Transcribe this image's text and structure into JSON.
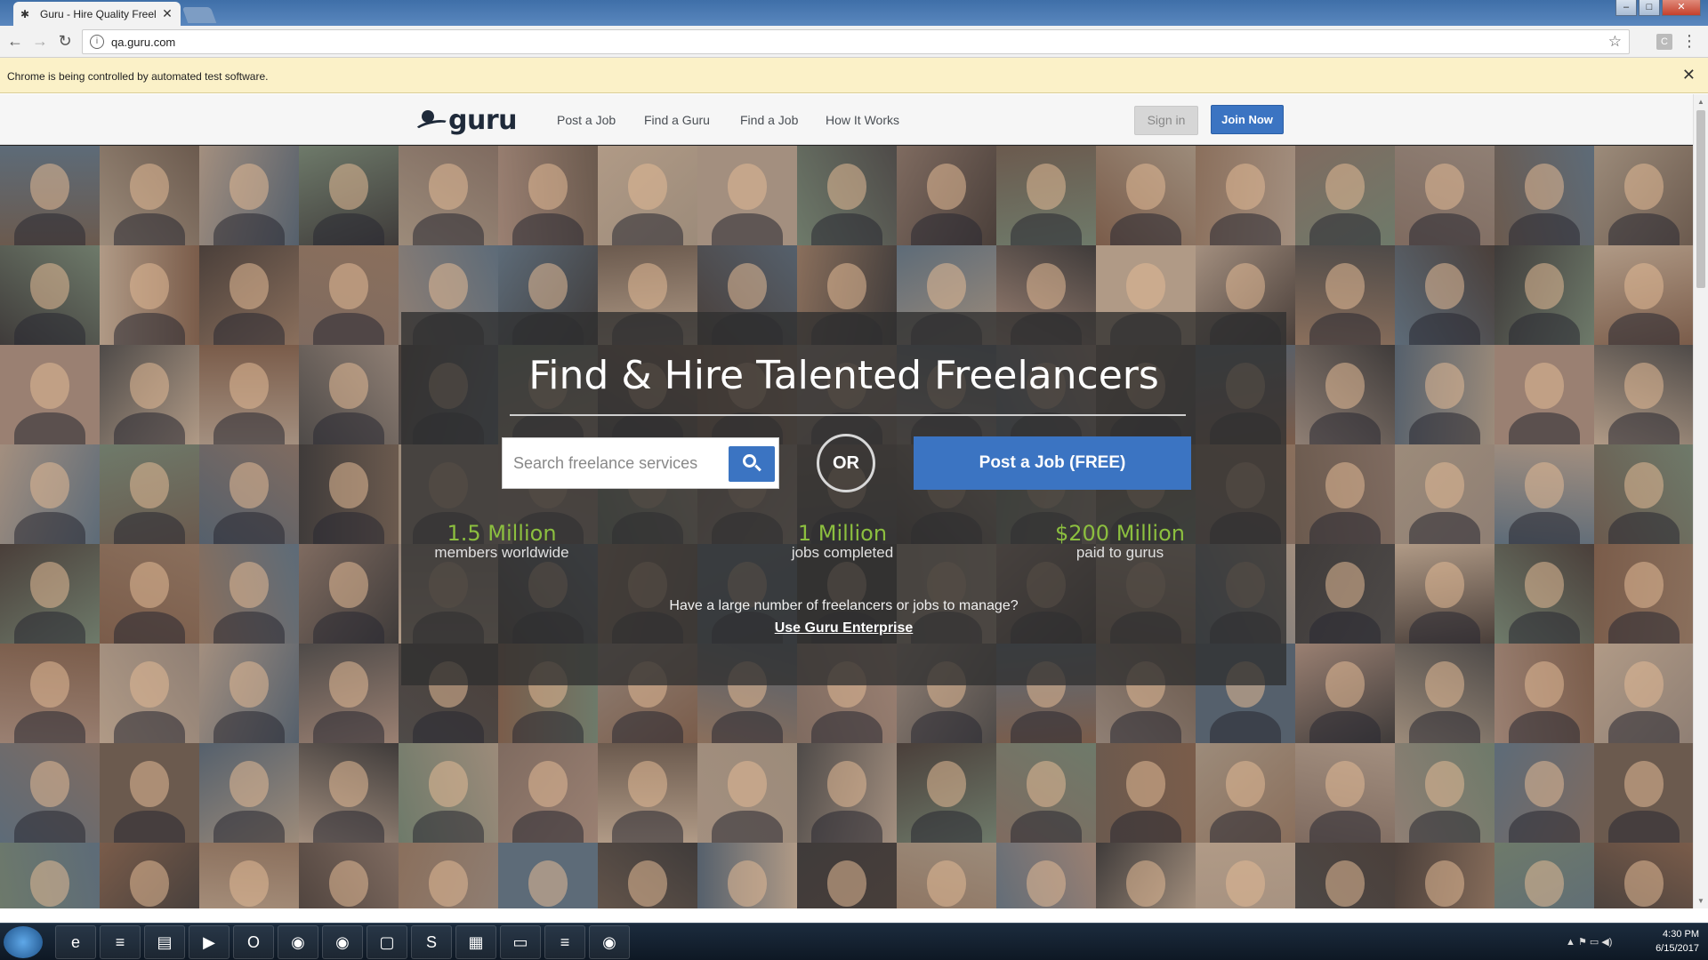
{
  "browser": {
    "tab_title": "Guru - Hire Quality Freel",
    "tab_close": "✕",
    "url": "qa.guru.com",
    "infobar_text": "Chrome is being controlled by automated test software.",
    "infobar_close": "✕",
    "window_controls": {
      "minimize": "–",
      "maximize": "□",
      "close": "✕"
    },
    "icons": {
      "back": "back-arrow-icon",
      "forward": "forward-arrow-icon",
      "reload": "reload-icon",
      "info": "info-icon",
      "star": "bookmark-star-icon",
      "menu": "menu-icon"
    }
  },
  "site_nav": {
    "logo_text": "guru",
    "links": [
      "Post a Job",
      "Find a Guru",
      "Find a Job",
      "How It Works"
    ],
    "sign_in": "Sign in",
    "join_now": "Join Now"
  },
  "hero": {
    "title": "Find & Hire Talented Freelancers",
    "search_placeholder": "Search freelance services",
    "or_label": "OR",
    "post_job_label": "Post a Job (FREE)",
    "stats": [
      {
        "number": "1.5 Million",
        "label": "members worldwide"
      },
      {
        "number": "1 Million",
        "label": "jobs completed"
      },
      {
        "number": "$200 Million",
        "label": "paid to gurus"
      }
    ],
    "enterprise_question": "Have a large number of freelancers or jobs to manage?",
    "enterprise_link": "Use Guru Enterprise"
  },
  "colors": {
    "accent_blue": "#3b74c2",
    "stat_green": "#8cbf3f",
    "infobar_bg": "#fbf1c8"
  },
  "taskbar": {
    "time": "4:30 PM",
    "date": "6/15/2017",
    "apps": [
      "ie-icon",
      "remote-desktop-icon",
      "file-explorer-icon",
      "media-player-icon",
      "outlook-icon",
      "chrome-icon",
      "firefox-icon",
      "folder-icon",
      "skype-icon",
      "control-panel-icon",
      "notepad-icon",
      "remote-desktop-icon-2",
      "chrome-icon-2"
    ]
  }
}
